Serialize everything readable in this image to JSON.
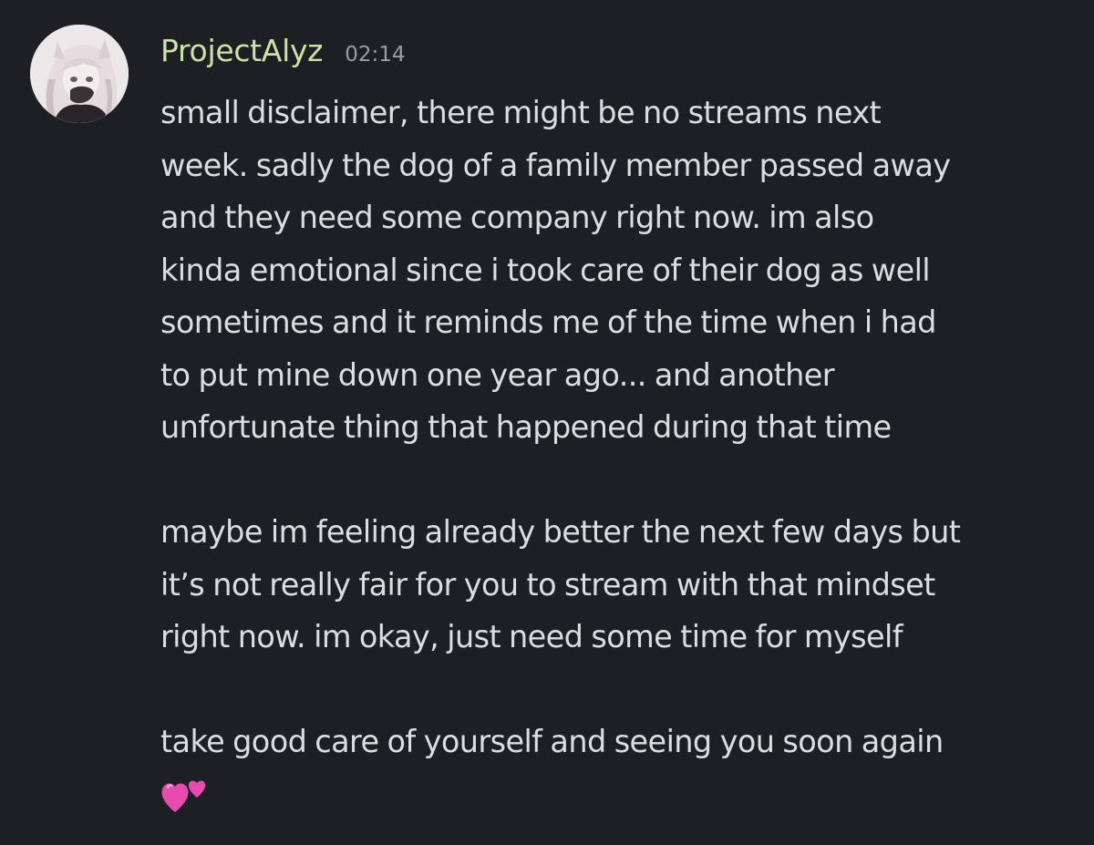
{
  "message": {
    "author": "ProjectAlyz",
    "time": "02:14",
    "lines": [
      "small disclaimer, there might be no streams next",
      "week. sadly the dog of a family member passed away",
      "and they need some company right now. im also",
      "kinda emotional since i took care of their dog as well",
      "sometimes and it reminds me of the time when i had",
      "to put mine down one year ago... and another",
      "unfortunate thing that happened during that time",
      "",
      "maybe im feeling already better the next few days but",
      "it’s not really fair for you to stream with that mindset",
      "right now. im okay, just need some time for myself",
      "",
      "take good care of yourself and seeing you soon again"
    ],
    "emoji": "two-hearts-icon"
  },
  "colors": {
    "background": "#1e1f24",
    "username": "#c9e4a7",
    "text": "#dbdde1",
    "timestamp": "#9a9ba3",
    "heart": "#e64bb0"
  }
}
